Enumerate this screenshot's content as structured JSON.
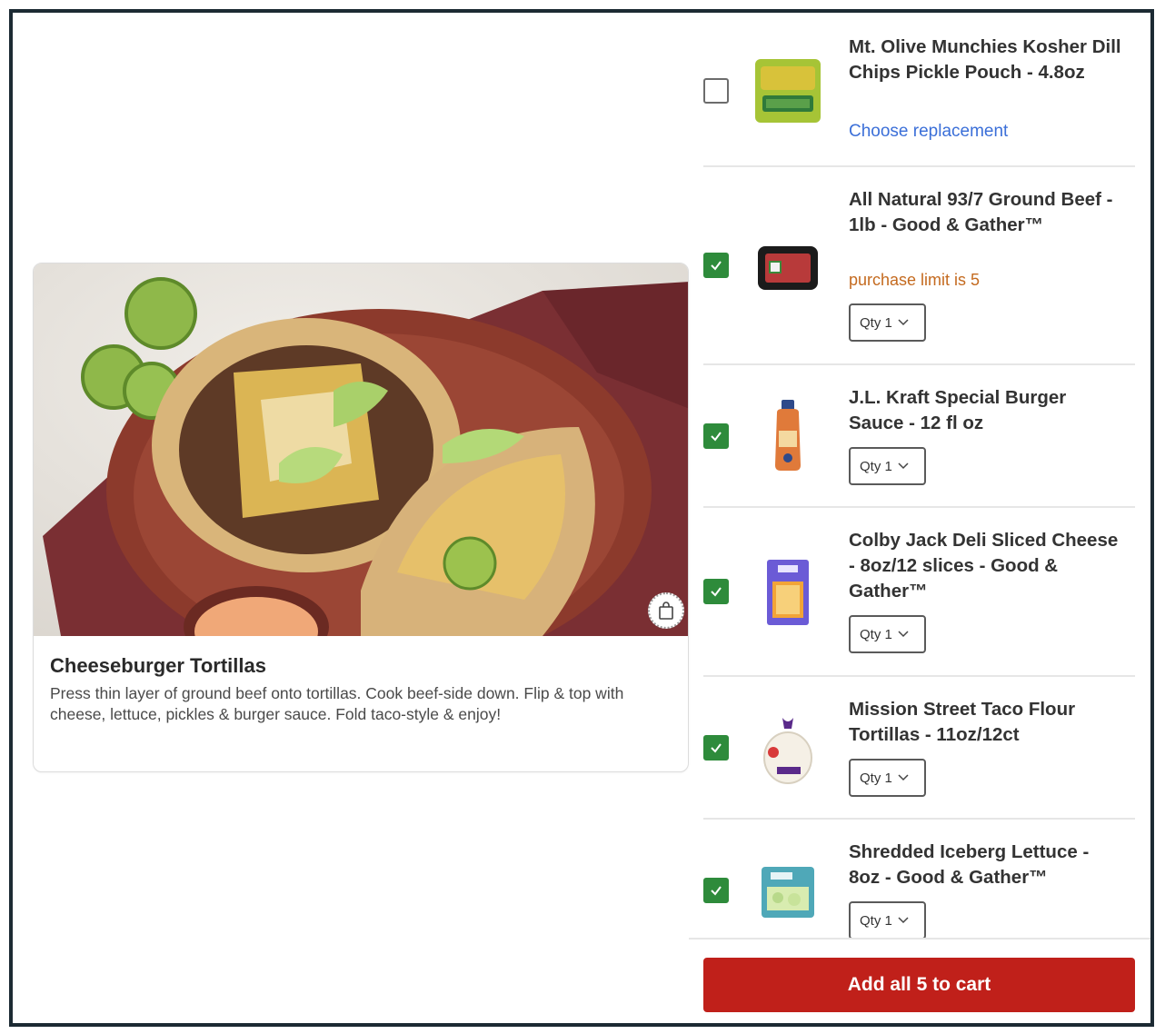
{
  "recipe": {
    "title": "Cheeseburger Tortillas",
    "description": "Press thin layer of ground beef onto tortillas. Cook beef-side down. Flip & top with cheese, lettuce, pickles & burger sauce. Fold taco-style & enjoy!",
    "image_icon": "cheeseburger-tortillas-photo",
    "save_icon": "shopping-bag-icon"
  },
  "products": [
    {
      "name": "Mt. Olive Munchies Kosher Dill Chips Pickle Pouch - 4.8oz",
      "checked": false,
      "replacement_link": "Choose replacement",
      "thumb_icon": "pickle-pouch-icon"
    },
    {
      "name": "All Natural 93/7 Ground Beef - 1lb - Good & Gather™",
      "checked": true,
      "note": "purchase limit is 5",
      "qty": "Qty 1",
      "thumb_icon": "ground-beef-tray-icon"
    },
    {
      "name": "J.L. Kraft Special Burger Sauce - 12 fl oz",
      "checked": true,
      "qty": "Qty 1",
      "thumb_icon": "sauce-bottle-icon"
    },
    {
      "name": "Colby Jack Deli Sliced Cheese - 8oz/12 slices - Good & Gather™",
      "checked": true,
      "qty": "Qty 1",
      "thumb_icon": "cheese-pack-icon"
    },
    {
      "name": "Mission Street Taco Flour Tortillas - 11oz/12ct",
      "checked": true,
      "qty": "Qty 1",
      "thumb_icon": "tortilla-bag-icon"
    },
    {
      "name": "Shredded Iceberg Lettuce - 8oz - Good & Gather™",
      "checked": true,
      "qty": "Qty 1",
      "thumb_icon": "lettuce-bag-icon"
    }
  ],
  "cart": {
    "add_all_label": "Add all 5 to cart"
  },
  "colors": {
    "accent_red": "#c0201a",
    "check_green": "#2e8b3b",
    "link_blue": "#3b6fd8",
    "warning_orange": "#c46a1f"
  }
}
